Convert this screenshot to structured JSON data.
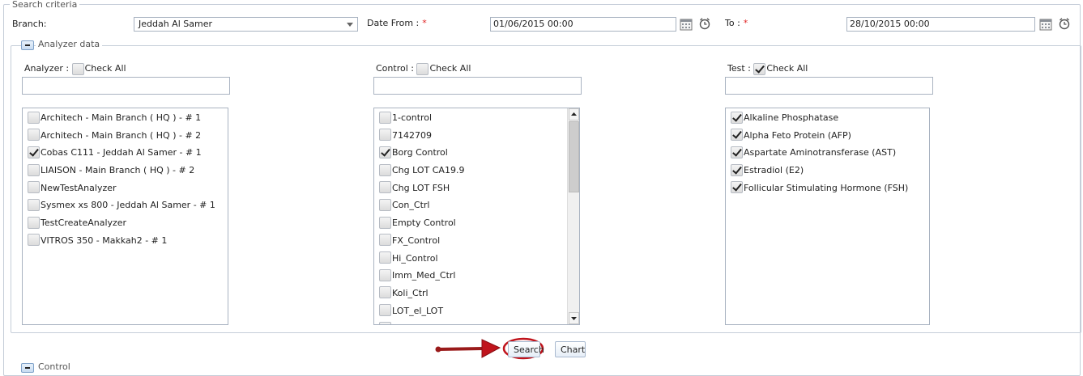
{
  "search_criteria": {
    "legend": "Search criteria",
    "branch_label": "Branch:",
    "branch_value": "Jeddah Al Samer",
    "date_from_label": "Date From :",
    "date_from_required": "*",
    "date_from_value": "01/06/2015 00:00",
    "to_label": "To :",
    "to_required": "*",
    "to_value": "28/10/2015 00:00"
  },
  "analyzer_data": {
    "legend": "Analyzer data",
    "analyzer": {
      "label": "Analyzer :",
      "check_all": "Check All",
      "check_all_checked": false,
      "items": [
        {
          "label": "Architech - Main Branch ( HQ ) - # 1",
          "checked": false
        },
        {
          "label": "Architech - Main Branch ( HQ ) - # 2",
          "checked": false
        },
        {
          "label": "Cobas C111 - Jeddah Al Samer - # 1",
          "checked": true
        },
        {
          "label": "LIAISON - Main Branch ( HQ ) - # 2",
          "checked": false
        },
        {
          "label": "NewTestAnalyzer",
          "checked": false
        },
        {
          "label": "Sysmex xs 800 - Jeddah Al Samer - # 1",
          "checked": false
        },
        {
          "label": "TestCreateAnalyzer",
          "checked": false
        },
        {
          "label": "VITROS 350 - Makkah2 - # 1",
          "checked": false
        }
      ]
    },
    "control": {
      "label": "Control :",
      "check_all": "Check All",
      "check_all_checked": false,
      "items": [
        {
          "label": "1-control",
          "checked": false
        },
        {
          "label": "7142709",
          "checked": false
        },
        {
          "label": "Borg Control",
          "checked": true
        },
        {
          "label": "Chg LOT CA19.9",
          "checked": false
        },
        {
          "label": "Chg LOT FSH",
          "checked": false
        },
        {
          "label": "Con_Ctrl",
          "checked": false
        },
        {
          "label": "Empty Control",
          "checked": false
        },
        {
          "label": "FX_Control",
          "checked": false
        },
        {
          "label": "Hi_Control",
          "checked": false
        },
        {
          "label": "Imm_Med_Ctrl",
          "checked": false
        },
        {
          "label": "Koli_Ctrl",
          "checked": false
        },
        {
          "label": "LOT_el_LOT",
          "checked": false
        },
        {
          "label": "Lo_Control",
          "checked": false
        }
      ]
    },
    "test": {
      "label": "Test :",
      "check_all": "Check All",
      "check_all_checked": true,
      "items": [
        {
          "label": "Alkaline Phosphatase",
          "checked": true
        },
        {
          "label": "Alpha Feto Protein (AFP)",
          "checked": true
        },
        {
          "label": "Aspartate Aminotransferase (AST)",
          "checked": true
        },
        {
          "label": "Estradiol (E2)",
          "checked": true
        },
        {
          "label": "Follicular Stimulating Hormone (FSH)",
          "checked": true
        }
      ]
    }
  },
  "actions": {
    "search_label": "Search",
    "chart_label": "Chart",
    "annotation_color": "#c0141c"
  },
  "next_section": {
    "legend": "Control"
  }
}
